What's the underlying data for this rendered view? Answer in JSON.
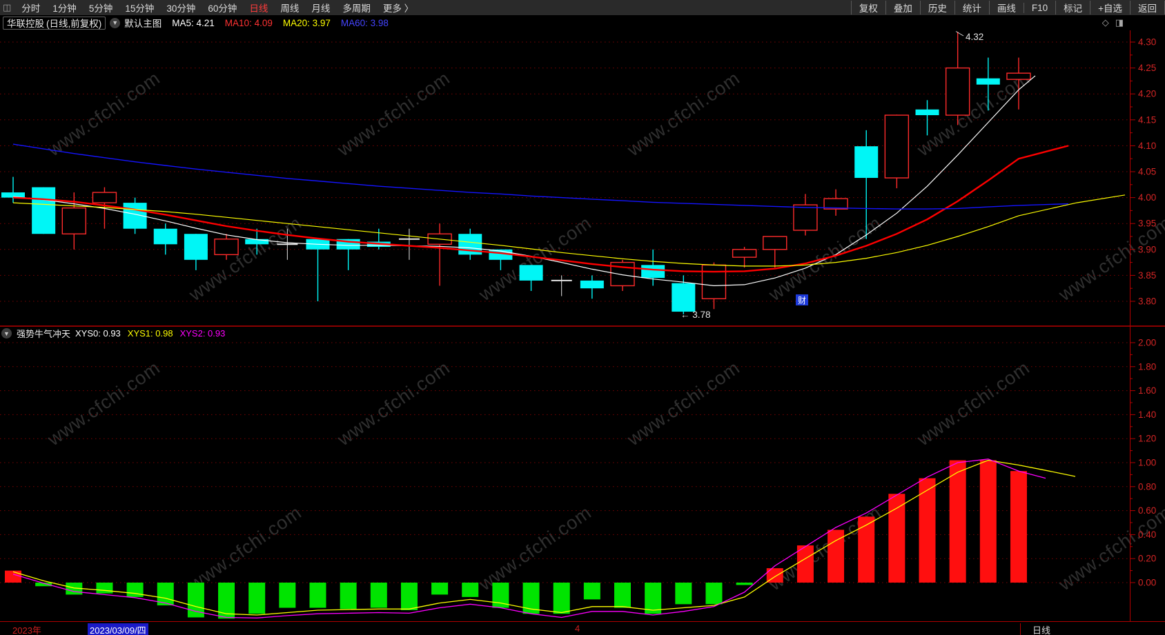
{
  "toolbar": {
    "periods": [
      "分时",
      "1分钟",
      "5分钟",
      "15分钟",
      "30分钟",
      "60分钟",
      "日线",
      "周线",
      "月线",
      "多周期",
      "更多 〉"
    ],
    "active_period": "日线",
    "right_buttons": [
      "复权",
      "叠加",
      "历史",
      "统计",
      "画线",
      "F10",
      "标记",
      "+自选",
      "返回"
    ]
  },
  "info_bar": {
    "stock_name": "华联控股",
    "stock_mode": "(日线,前复权)",
    "chart_type": "默认主图",
    "ma_labels": [
      {
        "text": "MA5: 4.21",
        "color": "#ffffff"
      },
      {
        "text": "MA10: 4.09",
        "color": "#ff3232"
      },
      {
        "text": "MA20: 3.97",
        "color": "#ffff00"
      },
      {
        "text": "MA60: 3.98",
        "color": "#4444ff"
      }
    ]
  },
  "sub_header": {
    "indicator_name": "强势牛气冲天",
    "items": [
      {
        "text": "XYS0: 0.93",
        "color": "#ffffff"
      },
      {
        "text": "XYS1: 0.98",
        "color": "#ffff00"
      },
      {
        "text": "XYS2: 0.93",
        "color": "#ff00ff"
      }
    ]
  },
  "bottom_bar": {
    "year": "2023年",
    "date": "2023/03/09/四",
    "month_marker": "4",
    "period_label": "日线"
  },
  "annotations": {
    "high_label": "4.32",
    "low_label": "3.78",
    "news_badge": "财"
  },
  "watermark": {
    "text": "www.cfchi.com",
    "color": "#2f2f2f"
  },
  "colors": {
    "candle_up": "#ff2b2b",
    "candle_down": "#00f6f6",
    "candle_flat": "#e8e8e8",
    "grid": "#7d0303",
    "axis": "#b40000",
    "axis_label": "#d42525",
    "bar_positive": "#ff0f0f",
    "bar_negative": "#00e400",
    "active_tab": "#ff3b3b",
    "date_highlight": "#1a1ac8",
    "news_badge_bg": "#1c39d8"
  },
  "chart_data": [
    {
      "type": "candlestick",
      "panel": "main",
      "security": "华联控股",
      "mode": "日线,前复权",
      "ylim": [
        3.77,
        4.335
      ],
      "grid": true,
      "y_ticks": [
        4.3,
        4.25,
        4.2,
        4.15,
        4.1,
        4.05,
        4.0,
        3.95,
        3.9,
        3.85,
        3.8
      ],
      "high_marker": {
        "value": 4.32,
        "candle_index": 31
      },
      "low_marker": {
        "value": 3.78,
        "candle_index": 22
      },
      "candles": [
        {
          "o": 4.01,
          "h": 4.04,
          "l": 3.99,
          "c": 4.0,
          "dir": "down"
        },
        {
          "o": 4.02,
          "h": 4.02,
          "l": 3.93,
          "c": 3.93,
          "dir": "down"
        },
        {
          "o": 3.93,
          "h": 4.01,
          "l": 3.9,
          "c": 3.98,
          "dir": "up"
        },
        {
          "o": 3.99,
          "h": 4.02,
          "l": 3.94,
          "c": 4.01,
          "dir": "up"
        },
        {
          "o": 3.99,
          "h": 4.0,
          "l": 3.93,
          "c": 3.94,
          "dir": "down"
        },
        {
          "o": 3.94,
          "h": 3.95,
          "l": 3.89,
          "c": 3.91,
          "dir": "down"
        },
        {
          "o": 3.93,
          "h": 3.93,
          "l": 3.86,
          "c": 3.88,
          "dir": "down"
        },
        {
          "o": 3.89,
          "h": 3.93,
          "l": 3.88,
          "c": 3.92,
          "dir": "up"
        },
        {
          "o": 3.92,
          "h": 3.94,
          "l": 3.89,
          "c": 3.91,
          "dir": "down"
        },
        {
          "o": 3.91,
          "h": 3.94,
          "l": 3.88,
          "c": 3.91,
          "dir": "flat"
        },
        {
          "o": 3.92,
          "h": 3.92,
          "l": 3.8,
          "c": 3.9,
          "dir": "down"
        },
        {
          "o": 3.92,
          "h": 3.92,
          "l": 3.86,
          "c": 3.9,
          "dir": "down"
        },
        {
          "o": 3.915,
          "h": 3.94,
          "l": 3.9,
          "c": 3.905,
          "dir": "down"
        },
        {
          "o": 3.92,
          "h": 3.94,
          "l": 3.88,
          "c": 3.92,
          "dir": "flat"
        },
        {
          "o": 3.91,
          "h": 3.95,
          "l": 3.83,
          "c": 3.93,
          "dir": "up"
        },
        {
          "o": 3.93,
          "h": 3.94,
          "l": 3.88,
          "c": 3.89,
          "dir": "down"
        },
        {
          "o": 3.9,
          "h": 3.9,
          "l": 3.86,
          "c": 3.88,
          "dir": "down"
        },
        {
          "o": 3.87,
          "h": 3.87,
          "l": 3.82,
          "c": 3.84,
          "dir": "down"
        },
        {
          "o": 3.84,
          "h": 3.85,
          "l": 3.81,
          "c": 3.84,
          "dir": "flat"
        },
        {
          "o": 3.84,
          "h": 3.85,
          "l": 3.805,
          "c": 3.825,
          "dir": "down"
        },
        {
          "o": 3.83,
          "h": 3.88,
          "l": 3.82,
          "c": 3.875,
          "dir": "up"
        },
        {
          "o": 3.87,
          "h": 3.9,
          "l": 3.83,
          "c": 3.845,
          "dir": "down"
        },
        {
          "o": 3.835,
          "h": 3.85,
          "l": 3.775,
          "c": 3.78,
          "dir": "down"
        },
        {
          "o": 3.805,
          "h": 3.875,
          "l": 3.785,
          "c": 3.87,
          "dir": "up"
        },
        {
          "o": 3.885,
          "h": 3.905,
          "l": 3.865,
          "c": 3.9,
          "dir": "up"
        },
        {
          "o": 3.9,
          "h": 3.925,
          "l": 3.865,
          "c": 3.925,
          "dir": "up"
        },
        {
          "o": 3.937,
          "h": 4.007,
          "l": 3.927,
          "c": 3.986,
          "dir": "up"
        },
        {
          "o": 3.978,
          "h": 4.016,
          "l": 3.965,
          "c": 3.998,
          "dir": "up"
        },
        {
          "o": 4.099,
          "h": 4.13,
          "l": 3.92,
          "c": 4.038,
          "dir": "down"
        },
        {
          "o": 4.038,
          "h": 4.16,
          "l": 4.018,
          "c": 4.159,
          "dir": "up"
        },
        {
          "o": 4.17,
          "h": 4.188,
          "l": 4.12,
          "c": 4.159,
          "dir": "down"
        },
        {
          "o": 4.159,
          "h": 4.32,
          "l": 4.14,
          "c": 4.25,
          "dir": "up"
        },
        {
          "o": 4.23,
          "h": 4.27,
          "l": 4.168,
          "c": 4.218,
          "dir": "down"
        },
        {
          "o": 4.228,
          "h": 4.27,
          "l": 4.17,
          "c": 4.24,
          "dir": "up"
        }
      ],
      "ma_series": [
        {
          "name": "MA5",
          "color": "#ffffff",
          "width": 1.2,
          "current": 4.21,
          "values": [
            4.002,
            3.996,
            3.988,
            3.979,
            3.968,
            3.955,
            3.941,
            3.928,
            3.919,
            3.913,
            3.91,
            3.908,
            3.908,
            3.907,
            3.906,
            3.903,
            3.897,
            3.887,
            3.875,
            3.862,
            3.851,
            3.843,
            3.837,
            3.83,
            3.832,
            3.845,
            3.864,
            3.89,
            3.928,
            3.97,
            4.022,
            4.082,
            4.145,
            4.208
          ],
          "extend": [
            [
              1500,
              4.235
            ]
          ]
        },
        {
          "name": "MA10",
          "color": "#ff0000",
          "width": 2.4,
          "current": 4.09,
          "values": [
            4.0,
            3.997,
            3.992,
            3.985,
            3.977,
            3.967,
            3.956,
            3.945,
            3.936,
            3.928,
            3.921,
            3.915,
            3.911,
            3.907,
            3.903,
            3.898,
            3.893,
            3.886,
            3.879,
            3.872,
            3.866,
            3.861,
            3.858,
            3.857,
            3.858,
            3.863,
            3.873,
            3.888,
            3.907,
            3.93,
            3.958,
            3.993,
            4.033,
            4.075
          ],
          "extend": [
            [
              1548,
              4.1
            ]
          ]
        },
        {
          "name": "MA20",
          "color": "#ffff00",
          "width": 1.2,
          "current": 3.97,
          "values": [
            3.99,
            3.987,
            3.984,
            3.981,
            3.977,
            3.973,
            3.968,
            3.962,
            3.956,
            3.95,
            3.944,
            3.938,
            3.932,
            3.926,
            3.92,
            3.914,
            3.908,
            3.901,
            3.894,
            3.888,
            3.882,
            3.877,
            3.873,
            3.87,
            3.868,
            3.868,
            3.87,
            3.875,
            3.883,
            3.894,
            3.908,
            3.925,
            3.944,
            3.965
          ],
          "extend": [
            [
              1560,
              3.99
            ],
            [
              1630,
              4.005
            ]
          ]
        },
        {
          "name": "MA60",
          "color": "#1414ff",
          "width": 1.4,
          "current": 3.98,
          "values": [
            4.103,
            4.094,
            4.085,
            4.077,
            4.069,
            4.062,
            4.055,
            4.049,
            4.043,
            4.037,
            4.032,
            4.027,
            4.022,
            4.018,
            4.014,
            4.01,
            4.007,
            4.003,
            4.0,
            3.997,
            3.994,
            3.991,
            3.989,
            3.987,
            3.985,
            3.983,
            3.981,
            3.98,
            3.979,
            3.978,
            3.978,
            3.979,
            3.982,
            3.985
          ],
          "extend": [
            [
              1548,
              3.988
            ]
          ]
        }
      ]
    },
    {
      "type": "bar",
      "panel": "indicator",
      "indicator": "强势牛气冲天",
      "ylim": [
        -0.33,
        2.12
      ],
      "grid": true,
      "y_ticks": [
        2.0,
        1.8,
        1.6,
        1.4,
        1.2,
        1.0,
        0.8,
        0.6,
        0.4,
        0.2,
        0.0
      ],
      "bar_values": [
        0.1,
        -0.03,
        -0.1,
        -0.09,
        -0.12,
        -0.19,
        -0.29,
        -0.3,
        -0.26,
        -0.21,
        -0.21,
        -0.22,
        -0.21,
        -0.23,
        -0.1,
        -0.12,
        -0.21,
        -0.26,
        -0.26,
        -0.14,
        -0.21,
        -0.26,
        -0.18,
        -0.18,
        -0.02,
        0.12,
        0.31,
        0.44,
        0.55,
        0.74,
        0.87,
        1.02,
        1.02,
        0.93
      ],
      "lines": [
        {
          "name": "XYS1",
          "color": "#ffff00",
          "width": 1.3,
          "current": 0.98,
          "values": [
            0.09,
            0.015,
            -0.045,
            -0.065,
            -0.09,
            -0.13,
            -0.2,
            -0.26,
            -0.27,
            -0.25,
            -0.23,
            -0.225,
            -0.22,
            -0.22,
            -0.17,
            -0.14,
            -0.17,
            -0.22,
            -0.25,
            -0.2,
            -0.2,
            -0.23,
            -0.21,
            -0.19,
            -0.12,
            0.05,
            0.2,
            0.35,
            0.48,
            0.62,
            0.77,
            0.92,
            1.02,
            0.98
          ],
          "extend": [
            [
              1520,
              0.93
            ],
            [
              1558,
              0.885
            ]
          ]
        },
        {
          "name": "XYS2",
          "color": "#ff00ff",
          "width": 1.3,
          "current": 0.93,
          "values": [
            0.07,
            -0.005,
            -0.075,
            -0.1,
            -0.125,
            -0.17,
            -0.24,
            -0.29,
            -0.295,
            -0.275,
            -0.26,
            -0.255,
            -0.25,
            -0.255,
            -0.21,
            -0.18,
            -0.21,
            -0.26,
            -0.29,
            -0.24,
            -0.24,
            -0.27,
            -0.24,
            -0.2,
            -0.08,
            0.14,
            0.3,
            0.46,
            0.58,
            0.73,
            0.88,
            1.0,
            1.03,
            0.93
          ],
          "extend": [
            [
              1515,
              0.87
            ]
          ]
        }
      ]
    }
  ]
}
